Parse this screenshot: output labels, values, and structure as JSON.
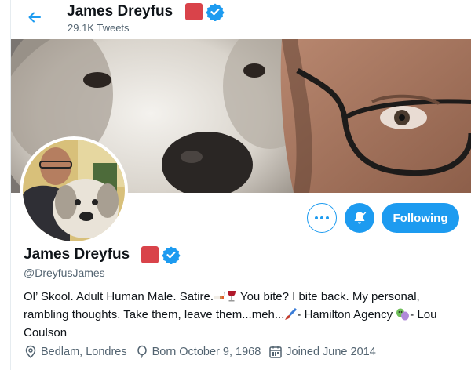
{
  "header": {
    "back_label": "Back",
    "name": "James Dreyfus",
    "tweet_count": "29.1K Tweets"
  },
  "profile": {
    "name": "James Dreyfus",
    "handle": "@DreyfusJames",
    "bio_part1": "Ol’ Skool. Adult Human Male. Satire.",
    "bio_part2": " You bite? I bite back. My personal, rambling thoughts. Take them, leave them...meh...",
    "bio_part3": "- Hamilton Agency ",
    "bio_part4": "- Lou Coulson",
    "location": "Bedlam, Londres",
    "birthday": "Born October 9, 1968",
    "joined": "Joined June 2014"
  },
  "actions": {
    "following_label": "Following"
  },
  "colors": {
    "accent": "#1d9bf0",
    "badge_red": "#d9434a",
    "secondary_text": "#536471"
  },
  "icons": {
    "back": "arrow-left-icon",
    "verified": "verified-badge-icon",
    "more": "more-dots-icon",
    "notifications": "bell-icon",
    "location": "location-pin-icon",
    "birthday": "balloon-icon",
    "joined": "calendar-icon"
  }
}
